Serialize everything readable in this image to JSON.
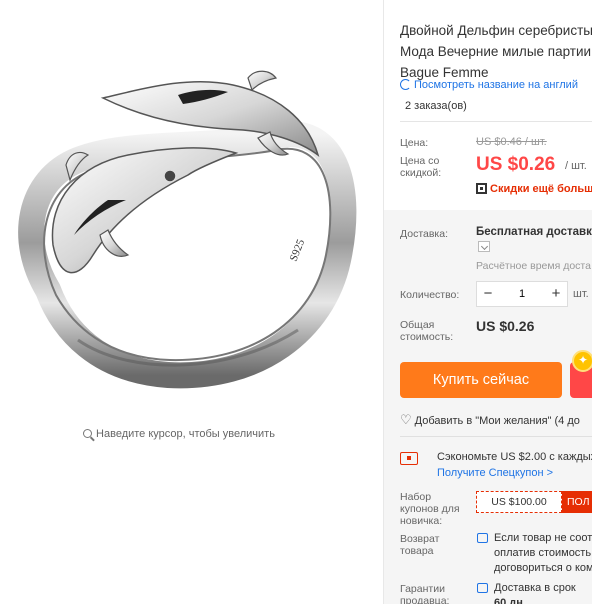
{
  "gallery": {
    "image_alt": "Серебряное кольцо с двумя дельфинами",
    "ring_stamp": "S925",
    "zoom_hint": "Наведите курсор, чтобы увеличить"
  },
  "product": {
    "title_lines": [
      "Двойной Дельфин серебристы",
      "Мода Вечерние милые партии",
      "Bague Femme"
    ],
    "translate_link": "Посмотреть название на англий",
    "orders": "2 заказа(ов)"
  },
  "price": {
    "price_label": "Цена:",
    "old_price": "US $0.46 / шт.",
    "discount_label_line1": "Цена со",
    "discount_label_line2": "скидкой:",
    "current_price": "US $0.26",
    "unit": "/ шт.",
    "extra_discount": "Скидки ещё больше"
  },
  "shipping": {
    "label": "Доставка:",
    "value": "Бесплатная доставка",
    "estimate": "Расчётное время доста"
  },
  "quantity": {
    "label": "Количество:",
    "minus": "−",
    "plus": "+",
    "value": "1",
    "unit": "шт."
  },
  "total": {
    "label_line1": "Общая",
    "label_line2": "стоимость:",
    "value": "US $0.26"
  },
  "actions": {
    "buy_now": "Купить сейчас",
    "coin_icon": "coin-icon",
    "wishlist": "Добавить в \"Мои желания\" (4 до"
  },
  "coupon": {
    "save_text": "Сэкономьте US $2.00 с каждых",
    "get_coupon": "Получите Спецкупон >",
    "new_label_lines": [
      "Набор",
      "купонов для",
      "новичка:"
    ],
    "new_amount": "US $100.00",
    "new_button": "ПОЛ"
  },
  "returns": {
    "label_lines": [
      "Возврат",
      "товара"
    ],
    "text_lines": [
      "Если товар не соот",
      "оплатив стоимость",
      "договориться о ком"
    ]
  },
  "guarantee": {
    "label_lines": [
      "Гарантии",
      "продавца:"
    ],
    "text_lines": [
      "Доставка в срок",
      "60 дн."
    ]
  },
  "colors": {
    "accent_red": "#ff4747",
    "buy_orange": "#ff7a1a",
    "link_blue": "#1f74e5"
  }
}
